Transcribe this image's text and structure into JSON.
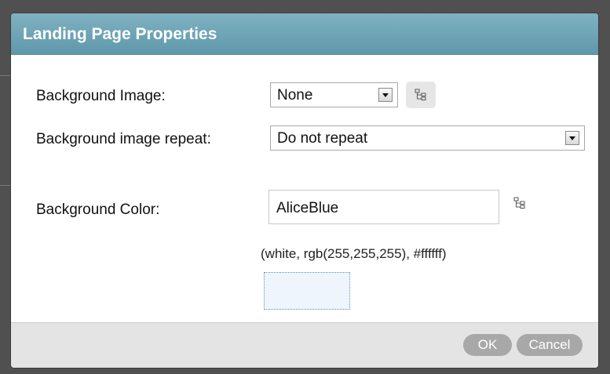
{
  "dialog": {
    "title": "Landing Page Properties"
  },
  "fields": {
    "background_image": {
      "label": "Background Image:",
      "value": "None"
    },
    "background_repeat": {
      "label": "Background image repeat:",
      "value": "Do not repeat"
    },
    "background_color": {
      "label": "Background Color:",
      "value": "AliceBlue",
      "hint": "(white, rgb(255,255,255), #ffffff)"
    }
  },
  "footer": {
    "ok_label": "OK",
    "cancel_label": "Cancel"
  },
  "icons": {
    "image_browse": "tree-icon",
    "color_picker": "tree-icon"
  },
  "colors": {
    "titlebar": "#6ca3b4",
    "swatch": "#eef5fc"
  }
}
